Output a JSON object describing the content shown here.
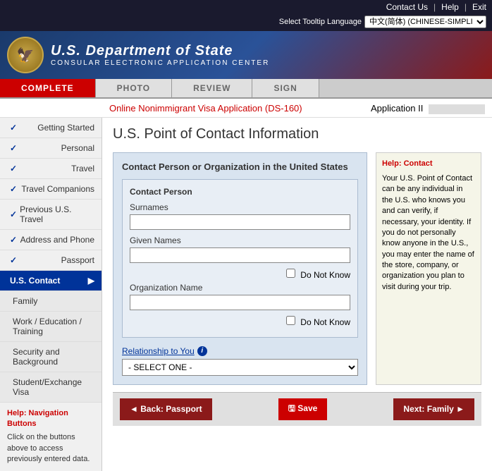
{
  "topbar": {
    "contact_us": "Contact Us",
    "help": "Help",
    "exit": "Exit"
  },
  "language": {
    "label": "Select Tooltip Language",
    "selected": "中文(简体) (CHINESE-SIMPLI"
  },
  "header": {
    "seal_icon": "🦅",
    "dept_name": "U.S. Department of State",
    "sub_name": "CONSULAR ELECTRONIC APPLICATION CENTER"
  },
  "nav_tabs": [
    {
      "label": "COMPLETE",
      "active": true
    },
    {
      "label": "PHOTO",
      "active": false
    },
    {
      "label": "REVIEW",
      "active": false
    },
    {
      "label": "SIGN",
      "active": false
    }
  ],
  "app_header": {
    "title": "Online Nonimmigrant Visa Application (DS-160)",
    "app_label": "Application II"
  },
  "page_title": "U.S. Point of Contact Information",
  "sidebar": {
    "items": [
      {
        "label": "Getting Started",
        "check": true,
        "active": false
      },
      {
        "label": "Personal",
        "check": true,
        "active": false
      },
      {
        "label": "Travel",
        "check": true,
        "active": false
      },
      {
        "label": "Travel Companions",
        "check": true,
        "active": false
      },
      {
        "label": "Previous U.S. Travel",
        "check": true,
        "active": false
      },
      {
        "label": "Address and Phone",
        "check": true,
        "active": false
      },
      {
        "label": "Passport",
        "check": true,
        "active": false
      },
      {
        "label": "U.S. Contact",
        "check": false,
        "active": true
      },
      {
        "label": "Family",
        "check": false,
        "active": false,
        "sub": true
      },
      {
        "label": "Work / Education / Training",
        "check": false,
        "active": false,
        "sub": true
      },
      {
        "label": "Security and Background",
        "check": false,
        "active": false,
        "sub": true
      },
      {
        "label": "Student/Exchange Visa",
        "check": false,
        "active": false,
        "sub": true
      }
    ],
    "help_title": "Help: Navigation Buttons",
    "help_text": "Click on the buttons above to access previously entered data."
  },
  "form": {
    "section_title": "Contact Person or Organization in the United States",
    "box_title": "Contact Person",
    "surnames_label": "Surnames",
    "given_names_label": "Given Names",
    "do_not_know_1": "Do Not Know",
    "do_not_know_2": "Do Not Know",
    "org_name_label": "Organization Name",
    "relationship_label": "Relationship to You",
    "select_default": "- SELECT ONE -"
  },
  "help": {
    "title": "Help:",
    "subtitle": "Contact",
    "text": "Your U.S. Point of Contact can be any individual in the U.S. who knows you and can verify, if necessary, your identity. If you do not personally know anyone in the U.S., you may enter the name of the store, company, or organization you plan to visit during your trip."
  },
  "bottom_nav": {
    "back_label": "◄ Back: Passport",
    "save_label": "🖫 Save",
    "next_label": "Next: Family ►"
  }
}
